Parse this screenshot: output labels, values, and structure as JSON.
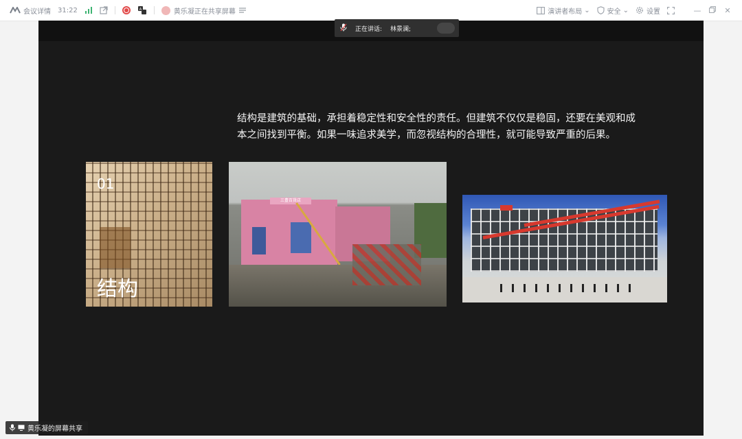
{
  "topbar": {
    "meeting_info": "会议详情",
    "duration": "31:22",
    "sharing_notice": "黄乐凝正在共享屏幕",
    "presenter_layout": "演讲者布局",
    "security": "安全",
    "settings": "设置"
  },
  "speaker_bar": {
    "label": "正在讲话:",
    "name": "林景澜;"
  },
  "slide": {
    "caption_line1": "结构是建筑的基础，承担着稳定性和安全性的责任。但建筑不仅仅是稳固，还要在美观和成",
    "caption_line2": "本之间找到平衡。如果一味追求美学，而忽视结构的合理性，就可能导致严重的后果。",
    "photo1_number": "01",
    "photo1_title": "结构",
    "photo2_sign": "三豊百貨店"
  },
  "sharer_label": "黄乐凝的屏幕共享",
  "colors": {
    "accent_red": "#e24a4a",
    "slide_bg": "#1a1a1a",
    "topbar_text": "#8a8f99"
  },
  "icons": [
    "logo-icon",
    "signal-icon",
    "popout-icon",
    "record-icon",
    "translate-icon",
    "user-avatar-icon",
    "list-icon",
    "layout-icon",
    "shield-icon",
    "gear-icon",
    "fullscreen-icon",
    "minimize-icon",
    "restore-icon",
    "close-icon",
    "mic-icon",
    "screen-icon"
  ]
}
